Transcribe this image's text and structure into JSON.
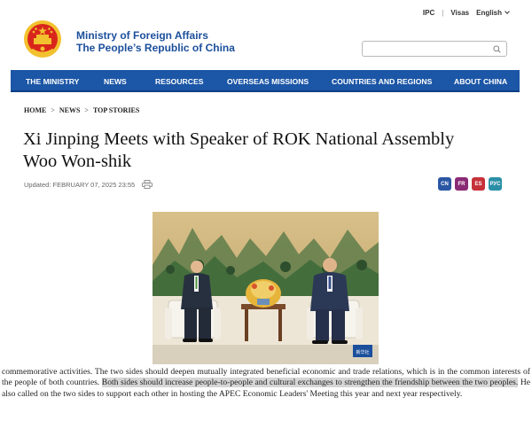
{
  "utility": {
    "ipc": "IPC",
    "sep": "|",
    "visas": "Visas",
    "language": "English"
  },
  "header": {
    "line1": "Ministry of Foreign Affairs",
    "line2": "The People’s Republic of China"
  },
  "search": {
    "placeholder": ""
  },
  "nav": {
    "items": [
      "THE MINISTRY",
      "NEWS",
      "RESOURCES",
      "OVERSEAS MISSIONS",
      "COUNTRIES AND REGIONS",
      "ABOUT CHINA"
    ]
  },
  "breadcrumb": {
    "home": "HOME",
    "news": "NEWS",
    "top": "TOP STORIES",
    "sep": ">"
  },
  "article": {
    "title_line1": "Xi Jinping Meets with Speaker of ROK National Assembly",
    "title_line2": "Woo Won-shik",
    "updated": "Updated: FEBRUARY 07, 2025 23:55",
    "photo_watermark": "新华社"
  },
  "lang_badges": [
    {
      "label": "CN",
      "color": "#2a56a3"
    },
    {
      "label": "FR",
      "color": "#8b2a74"
    },
    {
      "label": "ES",
      "color": "#c6323a"
    },
    {
      "label": "РУС",
      "color": "#2b8fa6"
    }
  ],
  "body": {
    "part1": "commemorative activities. The two sides should deepen mutually integrated beneficial economic and trade relations, which is in the common interests of the people of both countries.",
    "highlight": "Both sides should increase people-to-people and cultural exchanges to strengthen the friendship between the two peoples.",
    "part2": "He also called on the two sides to support each other in hosting the APEC Economic Leaders' Meeting this year and next year respectively."
  },
  "colors": {
    "nav": "#1c56a6",
    "brand_text": "#1c4f9c",
    "emblem_red": "#d9261c",
    "emblem_gold": "#f2c12e",
    "highlight": "#d6d6d6"
  }
}
